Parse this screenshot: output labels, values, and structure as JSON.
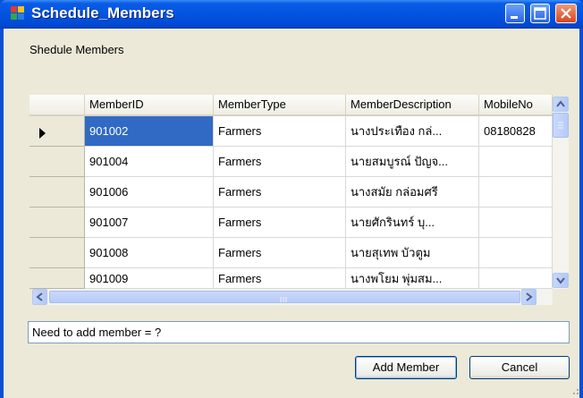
{
  "window": {
    "title": "Schedule_Members"
  },
  "section_label": "Shedule Members",
  "grid": {
    "columns": [
      "MemberID",
      "MemberType",
      "MemberDescription",
      "MobileNo"
    ],
    "rows": [
      [
        "901002",
        "Farmers",
        "นางประเทือง กล่...",
        "08180828"
      ],
      [
        "901004",
        "Farmers",
        "นายสมบูรณ์ ปัญจ...",
        ""
      ],
      [
        "901006",
        "Farmers",
        "นางสมัย กล่อมศรี",
        ""
      ],
      [
        "901007",
        "Farmers",
        "นายศักรินทร์ บุ...",
        ""
      ],
      [
        "901008",
        "Farmers",
        "นายสุเทพ บัวตูม",
        ""
      ],
      [
        "901009",
        "Farmers",
        "นางพโยม พุ่มสม...",
        ""
      ]
    ],
    "selected_row": 0
  },
  "status_text": "Need to add member = ?",
  "buttons": {
    "add_member": "Add Member",
    "cancel": "Cancel"
  },
  "icons": {
    "app": "app-window-icon",
    "current_row": "row-indicator-icon"
  },
  "colors": {
    "title_bar": "#0354e0",
    "selection": "#316ac5",
    "close_button": "#d8451c"
  }
}
